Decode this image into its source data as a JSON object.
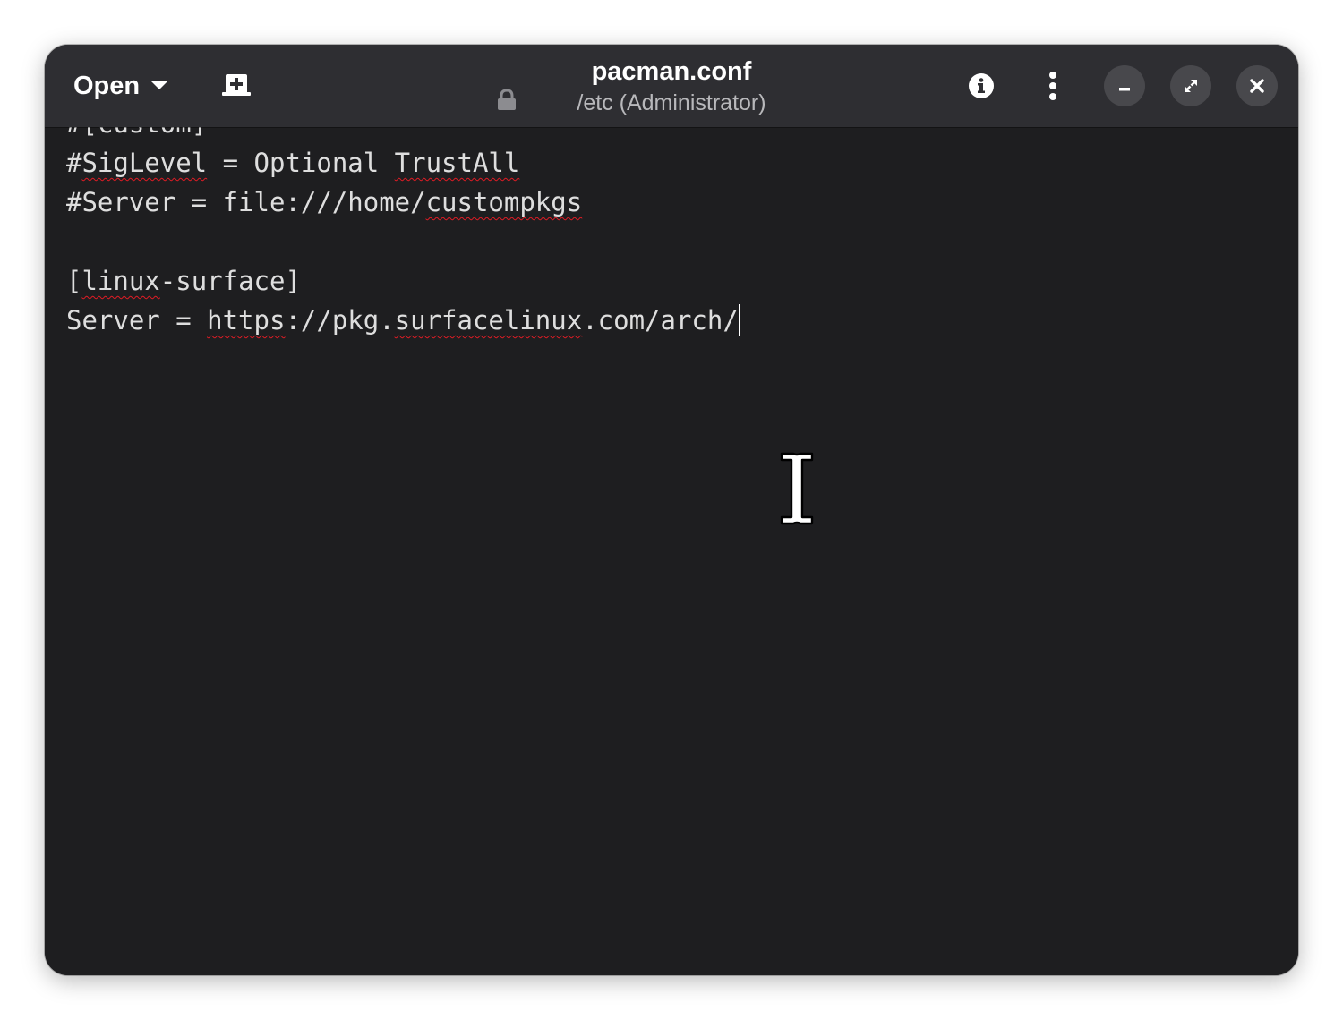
{
  "app": {
    "accent_color": "#e01b24"
  },
  "headerbar": {
    "open_label": "Open",
    "open_icon": "chevron-down-icon",
    "new_tab_icon": "new-tab-icon",
    "title": "pacman.conf",
    "subtitle": "/etc (Administrator)",
    "readonly_icon": "lock-icon",
    "info_icon": "info-icon",
    "menu_icon": "vertical-dots-icon",
    "window_controls": [
      "minimize-icon",
      "maximize-icon",
      "close-icon"
    ]
  },
  "editor": {
    "lines": [
      [
        {
          "t": "#[",
          "s": false
        },
        {
          "t": "custom",
          "s": false
        },
        {
          "t": "]",
          "s": false
        }
      ],
      [
        {
          "t": "#",
          "s": false
        },
        {
          "t": "SigLevel",
          "s": true
        },
        {
          "t": " = Optional ",
          "s": false
        },
        {
          "t": "TrustAll",
          "s": true
        }
      ],
      [
        {
          "t": "#Server = file:///home/",
          "s": false
        },
        {
          "t": "custompkgs",
          "s": true
        }
      ],
      [],
      [
        {
          "t": "[",
          "s": false
        },
        {
          "t": "linux",
          "s": true
        },
        {
          "t": "-surface]",
          "s": false
        }
      ],
      [
        {
          "t": "Server = ",
          "s": false
        },
        {
          "t": "https",
          "s": true
        },
        {
          "t": "://pkg.",
          "s": false
        },
        {
          "t": "surfacelinux",
          "s": true
        },
        {
          "t": ".com/arch/",
          "s": false
        }
      ]
    ],
    "caret_line": 5,
    "mouse_pointer_icon": "text-cursor-icon"
  }
}
